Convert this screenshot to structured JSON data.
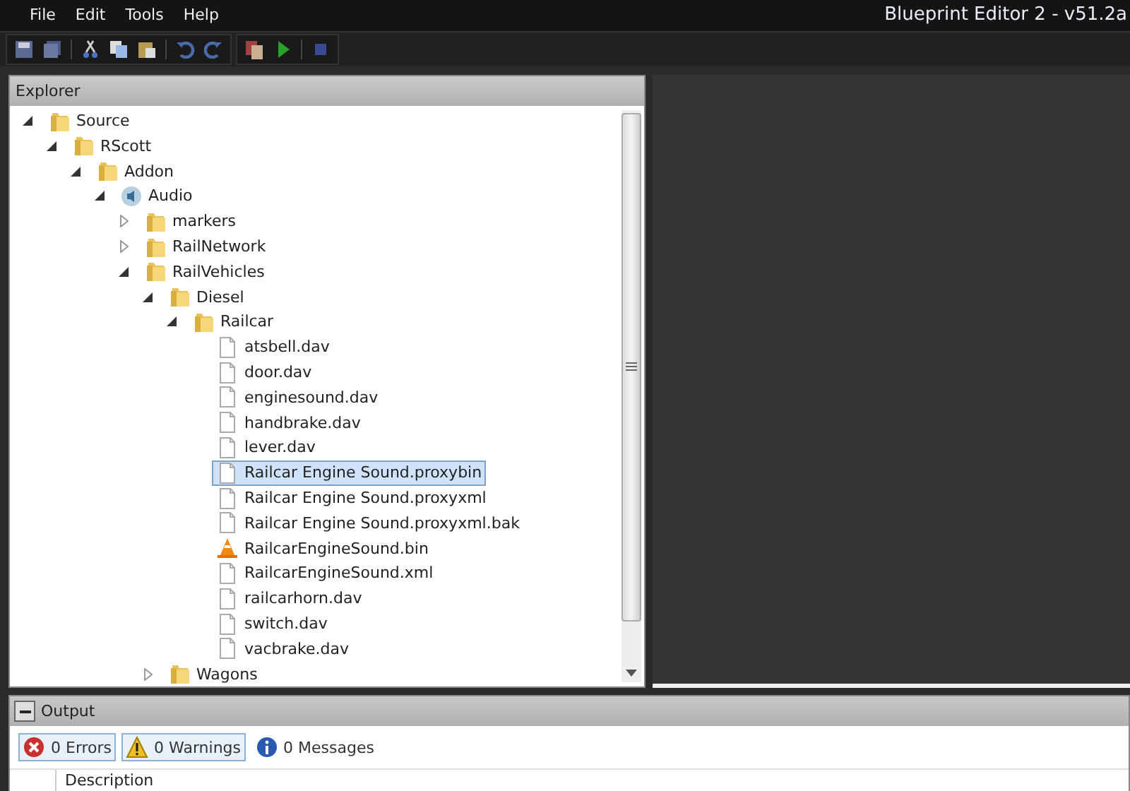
{
  "menu": [
    "File",
    "Edit",
    "Tools",
    "Help"
  ],
  "window": {
    "title": "Blueprint Editor 2 - v51.2a"
  },
  "explorer": {
    "title": "Explorer",
    "tree": [
      {
        "label": "Source",
        "kind": "folder",
        "expanded": true,
        "selected": false,
        "children": [
          {
            "label": "RScott",
            "kind": "folder",
            "expanded": true,
            "selected": false,
            "children": [
              {
                "label": "Addon",
                "kind": "folder",
                "expanded": true,
                "selected": false,
                "children": [
                  {
                    "label": "Audio",
                    "kind": "audio",
                    "expanded": true,
                    "selected": false,
                    "children": [
                      {
                        "label": "markers",
                        "kind": "folder",
                        "expanded": false,
                        "selected": false
                      },
                      {
                        "label": "RailNetwork",
                        "kind": "folder",
                        "expanded": false,
                        "selected": false
                      },
                      {
                        "label": "RailVehicles",
                        "kind": "folder",
                        "expanded": true,
                        "selected": false,
                        "children": [
                          {
                            "label": "Diesel",
                            "kind": "folder",
                            "expanded": true,
                            "selected": false,
                            "children": [
                              {
                                "label": "Railcar",
                                "kind": "folder",
                                "expanded": true,
                                "selected": false,
                                "children": [
                                  {
                                    "label": "atsbell.dav",
                                    "kind": "file",
                                    "selected": false
                                  },
                                  {
                                    "label": "door.dav",
                                    "kind": "file",
                                    "selected": false
                                  },
                                  {
                                    "label": "enginesound.dav",
                                    "kind": "file",
                                    "selected": false
                                  },
                                  {
                                    "label": "handbrake.dav",
                                    "kind": "file",
                                    "selected": false
                                  },
                                  {
                                    "label": "lever.dav",
                                    "kind": "file",
                                    "selected": false
                                  },
                                  {
                                    "label": "Railcar Engine Sound.proxybin",
                                    "kind": "file",
                                    "selected": true
                                  },
                                  {
                                    "label": "Railcar Engine Sound.proxyxml",
                                    "kind": "file",
                                    "selected": false
                                  },
                                  {
                                    "label": "Railcar Engine Sound.proxyxml.bak",
                                    "kind": "file",
                                    "selected": false
                                  },
                                  {
                                    "label": "RailcarEngineSound.bin",
                                    "kind": "cone",
                                    "selected": false
                                  },
                                  {
                                    "label": "RailcarEngineSound.xml",
                                    "kind": "file",
                                    "selected": false
                                  },
                                  {
                                    "label": "railcarhorn.dav",
                                    "kind": "file",
                                    "selected": false
                                  },
                                  {
                                    "label": "switch.dav",
                                    "kind": "file",
                                    "selected": false
                                  },
                                  {
                                    "label": "vacbrake.dav",
                                    "kind": "file",
                                    "selected": false
                                  }
                                ]
                              }
                            ]
                          },
                          {
                            "label": "Wagons",
                            "kind": "folder",
                            "expanded": false,
                            "selected": false
                          }
                        ]
                      }
                    ]
                  }
                ]
              }
            ]
          }
        ]
      }
    ]
  },
  "output": {
    "title": "Output",
    "filters": [
      {
        "label": "0 Errors",
        "kind": "error",
        "selected": true
      },
      {
        "label": "0 Warnings",
        "kind": "warning",
        "selected": true
      },
      {
        "label": "0 Messages",
        "kind": "info",
        "selected": false
      }
    ],
    "columns": [
      "Description"
    ]
  }
}
